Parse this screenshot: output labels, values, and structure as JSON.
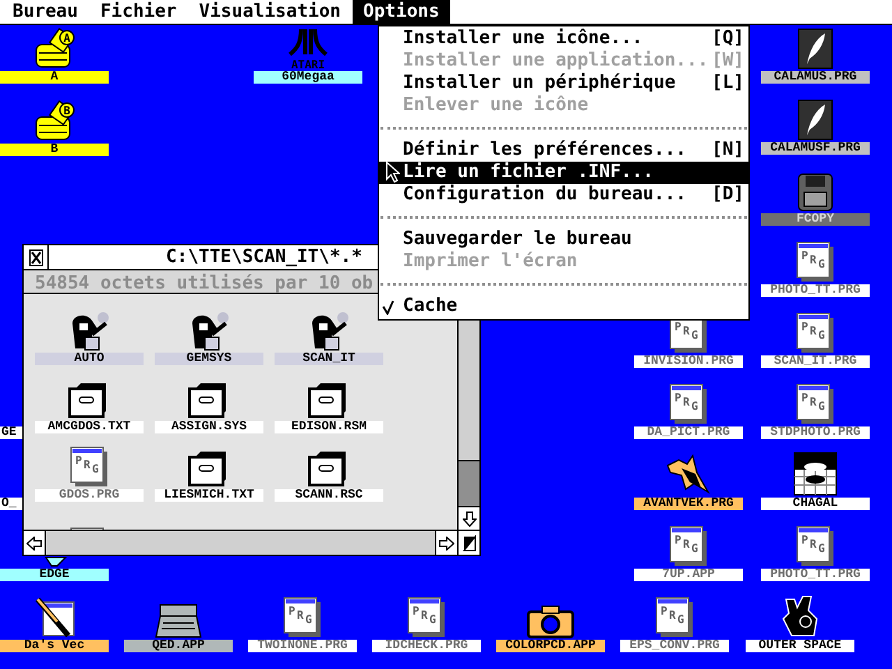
{
  "menu_bar": [
    {
      "label": "Bureau",
      "selected": false
    },
    {
      "label": "Fichier",
      "selected": false
    },
    {
      "label": "Visualisation",
      "selected": false
    },
    {
      "label": "Options",
      "selected": true
    }
  ],
  "options_menu": {
    "items": [
      {
        "kind": "item",
        "label": "Installer une icône...",
        "shortcut": "[Q]",
        "disabled": false,
        "selected": false,
        "checked": false
      },
      {
        "kind": "item",
        "label": "Installer une application...",
        "shortcut": "[W]",
        "disabled": true,
        "selected": false,
        "checked": false
      },
      {
        "kind": "item",
        "label": "Installer un périphérique",
        "shortcut": "[L]",
        "disabled": false,
        "selected": false,
        "checked": false
      },
      {
        "kind": "item",
        "label": "Enlever une icône",
        "disabled": true,
        "selected": false,
        "checked": false
      },
      {
        "kind": "separator"
      },
      {
        "kind": "item",
        "label": "Définir les préférences...",
        "shortcut": "[N]",
        "disabled": false,
        "selected": false,
        "checked": false
      },
      {
        "kind": "item",
        "label": "Lire un fichier .INF...",
        "disabled": false,
        "selected": true,
        "checked": false
      },
      {
        "kind": "item",
        "label": "Configuration du bureau...",
        "shortcut": "[D]",
        "disabled": false,
        "selected": false,
        "checked": false
      },
      {
        "kind": "separator"
      },
      {
        "kind": "item",
        "label": "Sauvegarder le bureau",
        "disabled": false,
        "selected": false,
        "checked": false
      },
      {
        "kind": "item",
        "label": "Imprimer l'écran",
        "disabled": true,
        "selected": false,
        "checked": false
      },
      {
        "kind": "separator"
      },
      {
        "kind": "item",
        "label": "Cache",
        "disabled": false,
        "selected": false,
        "checked": true
      }
    ]
  },
  "desktop_icons": [
    {
      "kind": "drive",
      "badge": "A",
      "label": "A",
      "color": "#ffff00"
    },
    {
      "kind": "atari",
      "icon_text": "ATARI",
      "label": "60Megaa",
      "color": "#a0ffff"
    },
    {
      "kind": "calamus",
      "label": "CALAMUS.PRG",
      "color": "#c0c0c0"
    },
    {
      "kind": "drive",
      "badge": "B",
      "label": "B",
      "color": "#ffff00"
    },
    {
      "kind": "calamus",
      "label": "CALAMUSF.PRG",
      "color": "#c0c0c0"
    },
    {
      "kind": "floppy",
      "label": "FCOPY",
      "color": "#707070"
    },
    {
      "kind": "prg",
      "icon_text": "PRG",
      "label": "PHOTO_TT.PRG",
      "color": "#ffffff"
    },
    {
      "kind": "prg",
      "icon_text": "PRG",
      "label": "INVISION.PRG",
      "color": "#ffffff"
    },
    {
      "kind": "prg",
      "icon_text": "PRG",
      "label": "SCAN_IT.PRG",
      "color": "#ffffff"
    },
    {
      "kind": "partial",
      "label": "GE",
      "color": "#ffffff"
    },
    {
      "kind": "prg",
      "icon_text": "PRG",
      "label": "DA_PICT.PRG",
      "color": "#ffffff"
    },
    {
      "kind": "prg",
      "icon_text": "PRG",
      "label": "STDPHOTO.PRG",
      "color": "#ffffff"
    },
    {
      "kind": "partial",
      "label": "O_",
      "color": "#ffffff"
    },
    {
      "kind": "bird",
      "label": "AVANTVEK.PRG",
      "color": "#ffc060"
    },
    {
      "kind": "chagal",
      "label": "CHAGAL",
      "color": "#ffffff"
    },
    {
      "kind": "edge",
      "label": "EDGE",
      "color": "#a0ffff"
    },
    {
      "kind": "prg",
      "icon_text": "PRG",
      "label": "7UP.APP",
      "color": "#ffffff"
    },
    {
      "kind": "prg",
      "icon_text": "PRG",
      "label": "PHOTO_TT.PRG",
      "color": "#ffffff"
    },
    {
      "kind": "pen",
      "label": "Da's Vec",
      "color": "#ffc060"
    },
    {
      "kind": "typewriter",
      "label": "QED.APP",
      "color": "#b0b8b8"
    },
    {
      "kind": "prg",
      "icon_text": "PRG",
      "label": "TWOINONE.PRG",
      "color": "#ffffff"
    },
    {
      "kind": "prg",
      "icon_text": "PRG",
      "label": "IDCHECK.PRG",
      "color": "#ffffff"
    },
    {
      "kind": "camera",
      "label": "COLORPCD.APP",
      "color": "#ffc060"
    },
    {
      "kind": "prg",
      "icon_text": "PRG",
      "label": "EPS_CONV.PRG",
      "color": "#ffffff"
    },
    {
      "kind": "bear",
      "label": "OUTER SPACE",
      "color": "#ffffff"
    }
  ],
  "window": {
    "title": "C:\\TTE\\SCAN_IT\\*.*",
    "info": "54854 octets utilisés par 10 ob",
    "files": [
      {
        "kind": "folder",
        "label": "AUTO",
        "color": "#d0d0e0"
      },
      {
        "kind": "folder",
        "label": "GEMSYS",
        "color": "#d0d0e0"
      },
      {
        "kind": "folder",
        "label": "SCAN_IT",
        "color": "#d0d0e0"
      },
      {
        "kind": "cabinet",
        "label": "AMCGDOS.TXT",
        "color": "#ffffff"
      },
      {
        "kind": "cabinet",
        "label": "ASSIGN.SYS",
        "color": "#ffffff"
      },
      {
        "kind": "cabinet",
        "label": "EDISON.RSM",
        "color": "#ffffff"
      },
      {
        "kind": "prg",
        "icon_text": "PRG",
        "label": "GDOS.PRG",
        "color": "#ffffff"
      },
      {
        "kind": "cabinet",
        "label": "LIESMICH.TXT",
        "color": "#ffffff"
      },
      {
        "kind": "cabinet",
        "label": "SCANN.RSC",
        "color": "#ffffff"
      },
      {
        "kind": "prg"
      }
    ]
  }
}
